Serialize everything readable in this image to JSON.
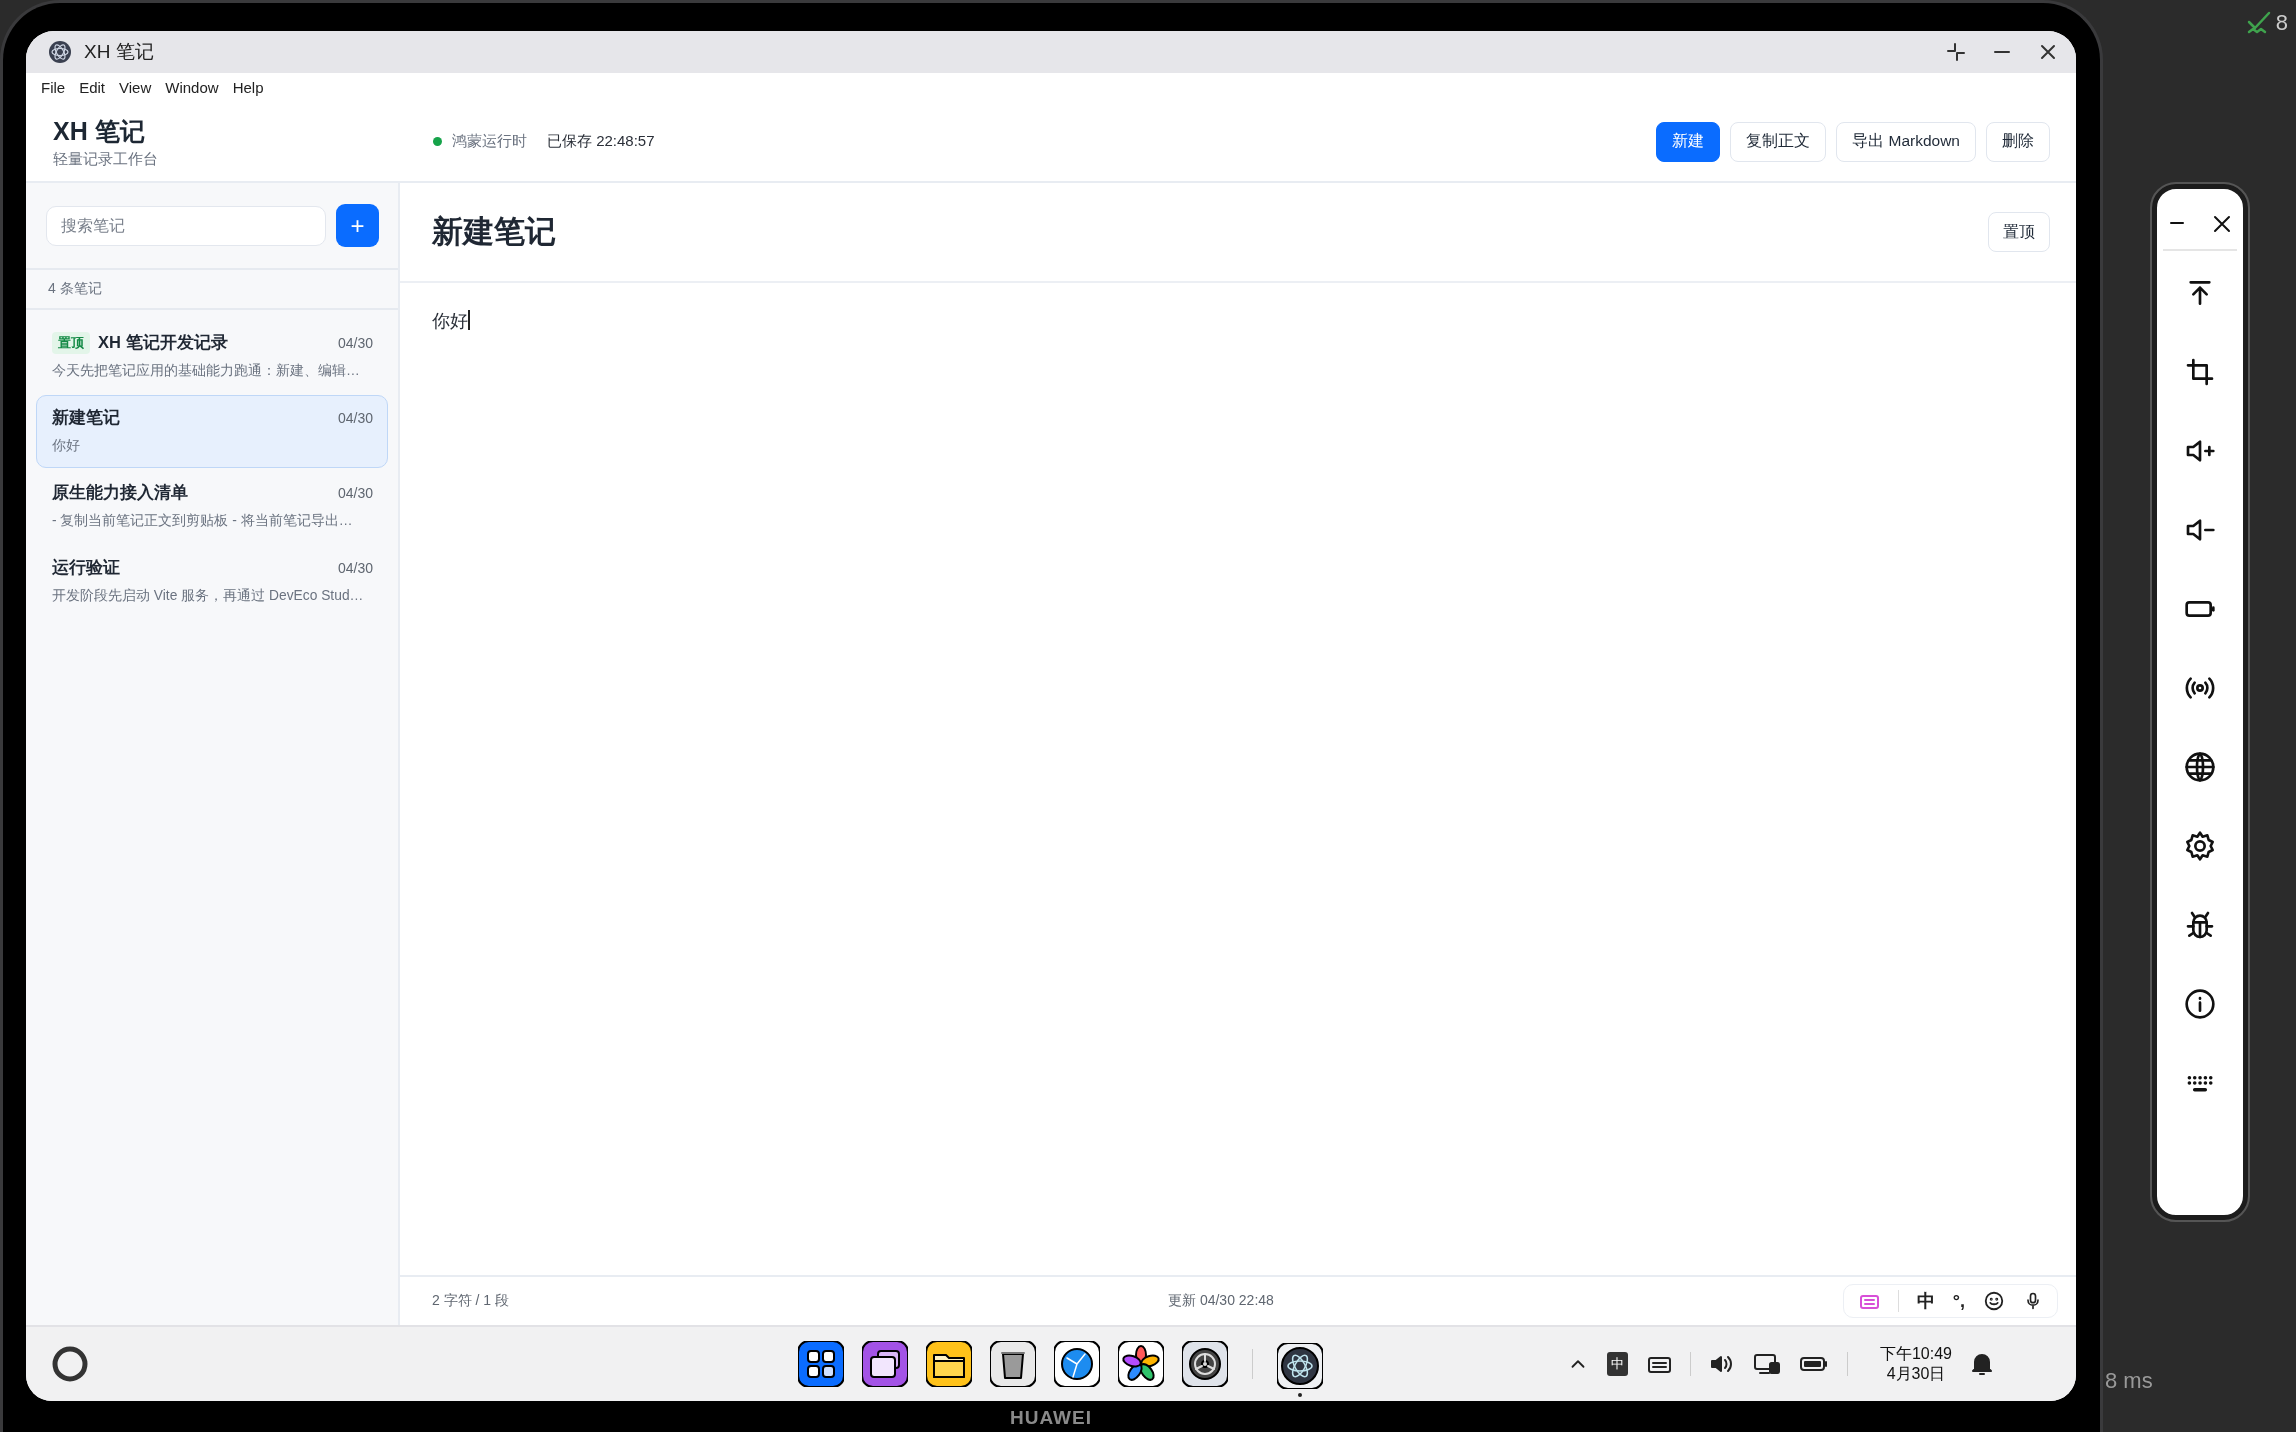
{
  "window": {
    "title": "XH 笔记"
  },
  "menu": [
    "File",
    "Edit",
    "View",
    "Window",
    "Help"
  ],
  "header": {
    "app_name": "XH 笔记",
    "subtitle": "轻量记录工作台",
    "runtime": "鸿蒙运行时",
    "saved": "已保存 22:48:57"
  },
  "actions": [
    {
      "label": "新建",
      "primary": true
    },
    {
      "label": "复制正文",
      "primary": false
    },
    {
      "label": "导出 Markdown",
      "primary": false
    },
    {
      "label": "删除",
      "primary": false
    }
  ],
  "sidebar": {
    "search": {
      "placeholder": "搜索笔记"
    },
    "add_button": "+",
    "count": "4 条笔记",
    "notes": [
      {
        "badge": "置顶",
        "title": "XH 笔记开发记录",
        "date": "04/30",
        "preview": "今天先把笔记应用的基础能力跑通：新建、编辑…",
        "selected": false
      },
      {
        "title": "新建笔记",
        "date": "04/30",
        "preview": "你好",
        "selected": true
      },
      {
        "title": "原生能力接入清单",
        "date": "04/30",
        "preview": "- 复制当前笔记正文到剪贴板 - 将当前笔记导出…",
        "selected": false
      },
      {
        "title": "运行验证",
        "date": "04/30",
        "preview": "开发阶段先启动 Vite 服务，再通过 DevEco Stud…",
        "selected": false
      }
    ]
  },
  "editor": {
    "title": "新建笔记",
    "pin_button": "置顶",
    "body": "你好",
    "stats": "2 字符 / 1 段",
    "updated": "更新 04/30 22:48",
    "ime": {
      "language": "中",
      "punctuation": "°,"
    }
  },
  "taskbar": {
    "ime": "中",
    "time": "下午10:49",
    "date": "4月30日"
  },
  "device": {
    "brand": "HUAWEI"
  },
  "background": {
    "counter": "8",
    "latency": "8 ms"
  }
}
